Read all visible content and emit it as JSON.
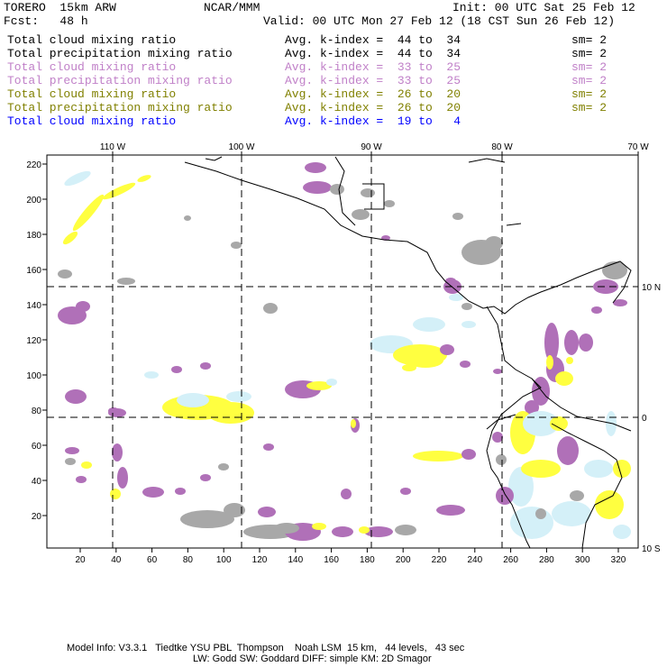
{
  "header": {
    "model": "TORERO  15km ARW",
    "org": "NCAR/MMM",
    "init": "Init: 00 UTC Sat 25 Feb 12",
    "fcst": "Fcst:   48 h",
    "valid": "Valid: 00 UTC Mon 27 Feb 12 (18 CST Sun 26 Feb 12)"
  },
  "legend": [
    {
      "field": "Total cloud mixing ratio",
      "range": "Avg. k-index =  44 to  34",
      "sm": "sm= 2",
      "color": "#000000"
    },
    {
      "field": "Total precipitation mixing ratio",
      "range": "Avg. k-index =  44 to  34",
      "sm": "sm= 2",
      "color": "#000000"
    },
    {
      "field": "Total cloud mixing ratio",
      "range": "Avg. k-index =  33 to  25",
      "sm": "sm= 2",
      "color": "#c080c8"
    },
    {
      "field": "Total precipitation mixing ratio",
      "range": "Avg. k-index =  33 to  25",
      "sm": "sm= 2",
      "color": "#c080c8"
    },
    {
      "field": "Total cloud mixing ratio",
      "range": "Avg. k-index =  26 to  20",
      "sm": "sm= 2",
      "color": "#808000"
    },
    {
      "field": "Total precipitation mixing ratio",
      "range": "Avg. k-index =  26 to  20",
      "sm": "sm= 2",
      "color": "#808000"
    },
    {
      "field": "Total cloud mixing ratio",
      "range": "Avg. k-index =  19 to   4",
      "sm": "",
      "color": "#0000ff"
    }
  ],
  "map": {
    "lon_labels": [
      "110 W",
      "100 W",
      "90 W",
      "80 W",
      "70 W"
    ],
    "lat_labels": [
      "10 N",
      "0",
      "10 S"
    ],
    "x_ticks": [
      "20",
      "40",
      "60",
      "80",
      "100",
      "120",
      "140",
      "160",
      "180",
      "200",
      "220",
      "240",
      "260",
      "280",
      "300",
      "320"
    ],
    "y_ticks": [
      "20",
      "40",
      "60",
      "80",
      "100",
      "120",
      "140",
      "160",
      "180",
      "200",
      "220"
    ],
    "colors": {
      "gray": "#a8a8a8",
      "purple": "#b070b8",
      "yellow": "#ffff40",
      "lightblue": "#d4f0f8"
    }
  },
  "footer": {
    "line1": "Model Info: V3.3.1   Tiedtke YSU PBL  Thompson    Noah LSM  15 km,   44 levels,   43 sec",
    "line2": "LW: Godd SW: Goddard DIFF: simple KM: 2D Smagor"
  }
}
